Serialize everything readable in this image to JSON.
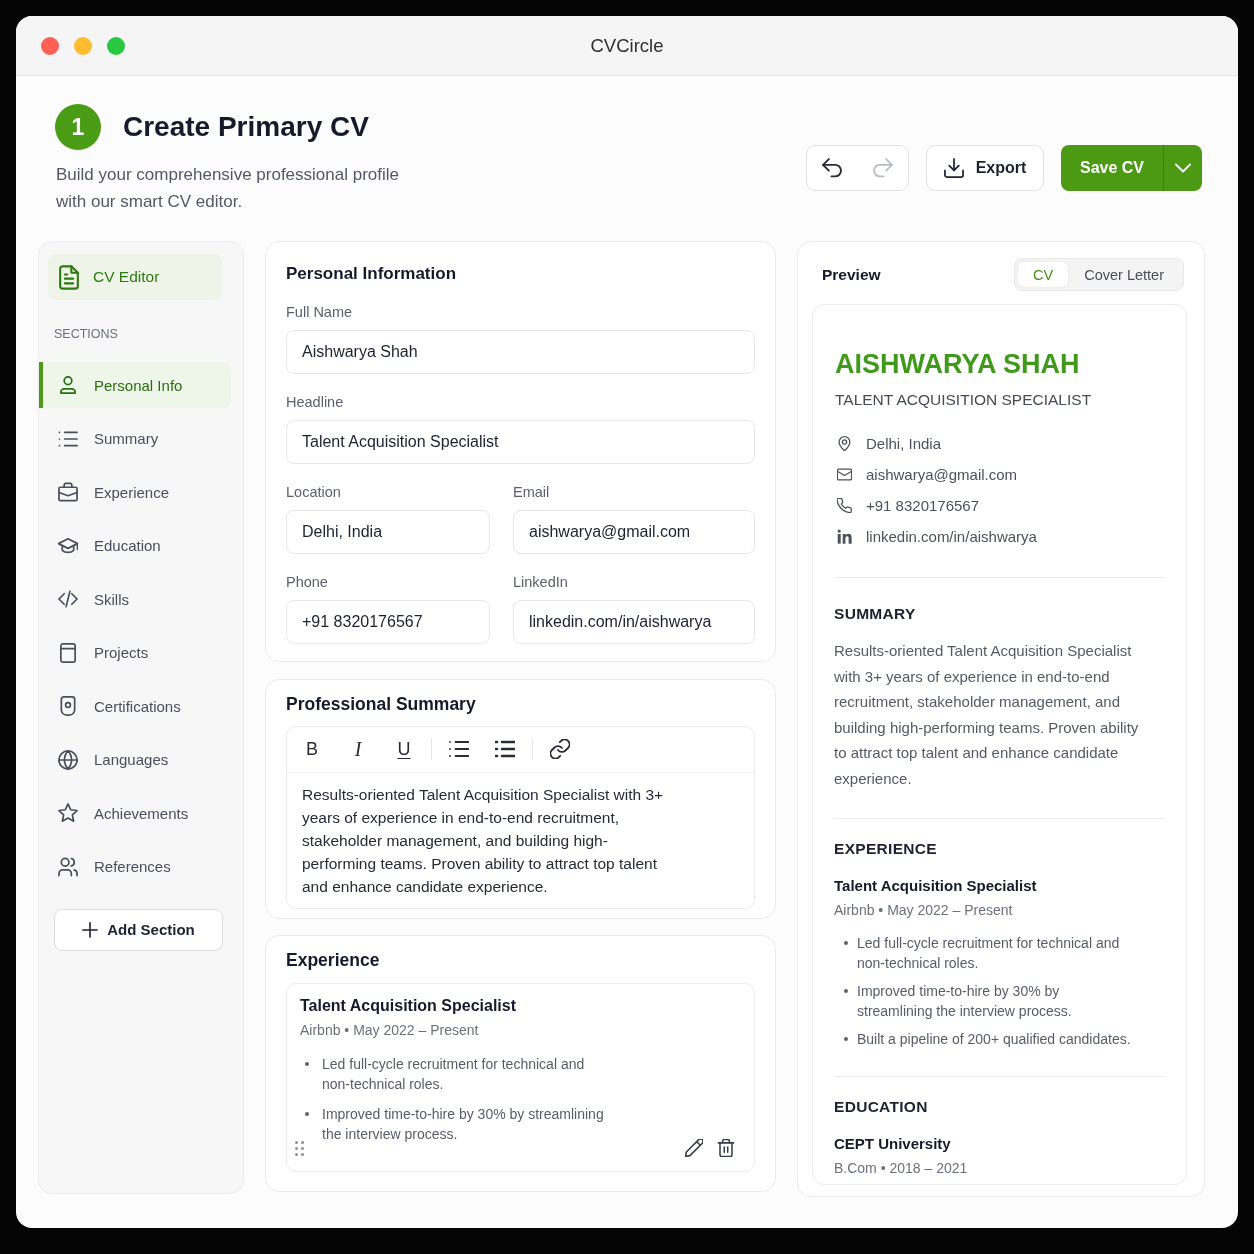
{
  "window": {
    "title": "CVCircle"
  },
  "header": {
    "step": "1",
    "title": "Create Primary CV",
    "subtitle": "Build your comprehensive professional profile with our smart CV editor.",
    "undo": {
      "disabled": false
    },
    "redo": {
      "disabled": true
    },
    "export_label": "Export",
    "save_label": "Save CV"
  },
  "sidebar": {
    "editor_label": "CV Editor",
    "sections_heading": "SECTIONS",
    "items": [
      {
        "label": "Personal Info",
        "selected": true
      },
      {
        "label": "Summary",
        "selected": false
      },
      {
        "label": "Experience",
        "selected": false
      },
      {
        "label": "Education",
        "selected": false
      },
      {
        "label": "Skills",
        "selected": false
      },
      {
        "label": "Projects",
        "selected": false
      },
      {
        "label": "Certifications",
        "selected": false
      },
      {
        "label": "Languages",
        "selected": false
      },
      {
        "label": "Achievements",
        "selected": false
      },
      {
        "label": "References",
        "selected": false
      }
    ],
    "add_label": "Add Section"
  },
  "personal_info": {
    "title": "Personal Information",
    "rows": [
      [
        {
          "label": "Full Name",
          "value": "Aishwarya Shah"
        }
      ],
      [
        {
          "label": "Headline",
          "value": "Talent Acquisition Specialist"
        }
      ],
      [
        {
          "label": "Location",
          "value": "Delhi, India"
        },
        {
          "label": "Email",
          "value": "aishwarya@gmail.com"
        }
      ],
      [
        {
          "label": "Phone",
          "value": "+91 8320176567"
        },
        {
          "label": "LinkedIn",
          "value": "linkedin.com/in/aishwarya"
        }
      ]
    ]
  },
  "professional_summary": {
    "title": "Professional Summary",
    "tool_groups": [
      [
        {
          "kind": "bold",
          "label": "B"
        },
        {
          "kind": "italic",
          "label": "I"
        },
        {
          "kind": "underline",
          "label": "U"
        }
      ],
      [
        {
          "kind": "list"
        },
        {
          "kind": "bullets"
        }
      ],
      [
        {
          "kind": "link"
        }
      ]
    ],
    "text": "Results-oriented Talent Acquisition Specialist with 3+ years of experience in end-to-end recruitment, stakeholder management, and building high-performing teams. Proven ability to attract top talent and enhance candidate experience."
  },
  "experience": {
    "title": "Experience",
    "entries": [
      {
        "title": "Talent Acquisition Specialist",
        "meta": "Airbnb • May 2022 – Present",
        "bullets": [
          "Led full-cycle recruitment for technical and non-technical roles.",
          "Improved time-to-hire by 30% by streamlining the interview process."
        ]
      }
    ]
  },
  "preview": {
    "title": "Preview",
    "tabs": [
      {
        "label": "CV",
        "selected": true
      },
      {
        "label": "Cover Letter",
        "selected": false
      }
    ],
    "name": "AISHWARYA SHAH",
    "headline": "TALENT ACQUISITION SPECIALIST",
    "contacts": [
      "Delhi, India",
      "aishwarya@gmail.com",
      "+91 8320176567",
      "linkedin.com/in/aishwarya"
    ],
    "sections": [
      {
        "kind": "summary",
        "heading": "SUMMARY",
        "text": "Results-oriented Talent Acquisition Specialist with 3+ years of experience in end-to-end recruitment, stakeholder management, and building high-performing teams. Proven ability to attract top talent and enhance candidate experience."
      },
      {
        "kind": "entries",
        "heading": "EXPERIENCE",
        "entries": [
          {
            "title": "Talent Acquisition Specialist",
            "meta": "Airbnb • May 2022 – Present",
            "bullets": [
              "Led full-cycle recruitment for technical and non-technical roles.",
              "Improved time-to-hire by 30% by streamlining the interview process.",
              "Built a pipeline of 200+ qualified candidates."
            ]
          }
        ]
      },
      {
        "kind": "entries",
        "heading": "EDUCATION",
        "entries": [
          {
            "title": "CEPT University",
            "meta": "B.Com • 2018 – 2021"
          }
        ]
      }
    ]
  }
}
